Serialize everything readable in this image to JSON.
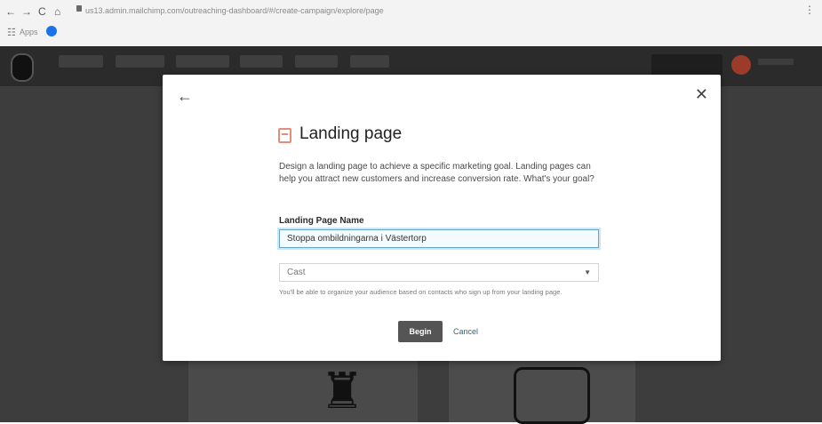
{
  "browser": {
    "nav": {
      "back": "←",
      "forward": "→",
      "reload": "C",
      "home": "⌂"
    },
    "url": "us13.admin.mailchimp.com/outreaching-dashboard/#/create-campaign/explore/page",
    "menu": "⋮",
    "apps_label": "Apps"
  },
  "modal": {
    "back": "←",
    "close": "✕",
    "title": "Landing page",
    "description": "Design a landing page to achieve a specific marketing goal. Landing pages can help you attract new customers and increase conversion rate. What's your goal?",
    "name_label": "Landing Page Name",
    "name_value": "Stoppa ombildningarna i Västertorp",
    "audience_value": "Cast",
    "help_text": "You'll be able to organize your audience based on contacts who sign up from your landing page.",
    "begin_label": "Begin",
    "cancel_label": "Cancel"
  },
  "colors": {
    "overlay": "#3d3d3d",
    "input_focus": "#6aa3c8",
    "begin_bg": "#555555",
    "cancel_link": "#26687e"
  }
}
